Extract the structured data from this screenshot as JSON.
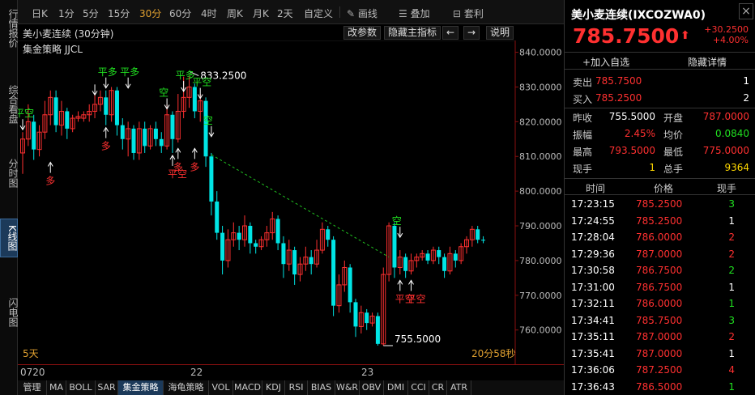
{
  "left_nav": [
    {
      "label": "行情报价",
      "active": false
    },
    {
      "label": "综合看盘",
      "active": false
    },
    {
      "label": "分时图",
      "active": false
    },
    {
      "label": "K线图",
      "active": true
    },
    {
      "label": "闪电图",
      "active": false
    }
  ],
  "toolbar": {
    "periods": [
      "日K",
      "1分",
      "5分",
      "15分",
      "30分",
      "60分",
      "4时",
      "周K",
      "月K",
      "2天",
      "自定义"
    ],
    "active_period": "30分",
    "draw_label": "画线",
    "overlay_label": "叠加",
    "arbitrage_label": "套利"
  },
  "chart_header": {
    "title": "美小麦连续 (30分钟)",
    "change_params": "改参数",
    "hide_indicator": "隐藏主指标",
    "left_arrow": "←",
    "right_arrow": "→",
    "explain": "说明",
    "strategy": "集金策略 JJCL"
  },
  "price_axis": {
    "ticks": [
      "840.0000",
      "830.0000",
      "820.0000",
      "810.0000",
      "800.0000",
      "790.0000",
      "780.0000",
      "770.0000",
      "760.0000"
    ]
  },
  "chart_labels": {
    "high_label": "833.2500",
    "low_label": "755.5000",
    "days": "5天",
    "countdown": "20分58秒"
  },
  "date_axis": [
    "0720",
    "22",
    "23"
  ],
  "signals": {
    "buy_open": "多",
    "close_short": "平空",
    "close_long": "平多",
    "sell_open": "空"
  },
  "chart_data": {
    "type": "candlestick",
    "ylim": [
      752,
      842
    ],
    "candles": [
      {
        "o": 811,
        "c": 815,
        "h": 817,
        "l": 805
      },
      {
        "o": 815,
        "c": 820,
        "h": 825,
        "l": 813
      },
      {
        "o": 820,
        "c": 812,
        "h": 822,
        "l": 809
      },
      {
        "o": 812,
        "c": 817,
        "h": 819,
        "l": 810
      },
      {
        "o": 817,
        "c": 822,
        "h": 826,
        "l": 815
      },
      {
        "o": 822,
        "c": 827,
        "h": 829,
        "l": 819
      },
      {
        "o": 827,
        "c": 819,
        "h": 829,
        "l": 817
      },
      {
        "o": 819,
        "c": 823,
        "h": 826,
        "l": 816
      },
      {
        "o": 823,
        "c": 818,
        "h": 824,
        "l": 815
      },
      {
        "o": 818,
        "c": 821,
        "h": 822,
        "l": 817
      },
      {
        "o": 821,
        "c": 821.5,
        "h": 823,
        "l": 820
      },
      {
        "o": 821,
        "c": 822,
        "h": 823,
        "l": 820
      },
      {
        "o": 822,
        "c": 823,
        "h": 825,
        "l": 820
      },
      {
        "o": 823,
        "c": 825,
        "h": 828,
        "l": 821
      },
      {
        "o": 825,
        "c": 827,
        "h": 829,
        "l": 823
      },
      {
        "o": 827,
        "c": 822,
        "h": 829,
        "l": 819
      },
      {
        "o": 822,
        "c": 829,
        "h": 830,
        "l": 820
      },
      {
        "o": 829,
        "c": 819,
        "h": 830,
        "l": 816
      },
      {
        "o": 819,
        "c": 815,
        "h": 821,
        "l": 812
      },
      {
        "o": 815,
        "c": 818,
        "h": 820,
        "l": 810
      },
      {
        "o": 818,
        "c": 811,
        "h": 819,
        "l": 809
      },
      {
        "o": 811,
        "c": 818,
        "h": 820,
        "l": 809
      },
      {
        "o": 818,
        "c": 813,
        "h": 820,
        "l": 811
      },
      {
        "o": 813,
        "c": 818,
        "h": 819,
        "l": 812
      },
      {
        "o": 818,
        "c": 815,
        "h": 820,
        "l": 813
      },
      {
        "o": 815,
        "c": 813,
        "h": 817,
        "l": 811
      },
      {
        "o": 813,
        "c": 822,
        "h": 825,
        "l": 812
      },
      {
        "o": 822,
        "c": 815,
        "h": 823,
        "l": 811
      },
      {
        "o": 815,
        "c": 823,
        "h": 828,
        "l": 814
      },
      {
        "o": 823,
        "c": 827,
        "h": 833,
        "l": 821
      },
      {
        "o": 827,
        "c": 830,
        "h": 833,
        "l": 824
      },
      {
        "o": 830,
        "c": 823,
        "h": 831,
        "l": 821
      },
      {
        "o": 823,
        "c": 826,
        "h": 828,
        "l": 820
      },
      {
        "o": 826,
        "c": 810,
        "h": 827,
        "l": 807
      },
      {
        "o": 810,
        "c": 797,
        "h": 811,
        "l": 793
      },
      {
        "o": 797,
        "c": 788,
        "h": 800,
        "l": 786
      },
      {
        "o": 788,
        "c": 780,
        "h": 790,
        "l": 776
      },
      {
        "o": 780,
        "c": 786,
        "h": 789,
        "l": 778
      },
      {
        "o": 786,
        "c": 788,
        "h": 791,
        "l": 784
      },
      {
        "o": 788,
        "c": 786,
        "h": 790,
        "l": 783
      },
      {
        "o": 786,
        "c": 790,
        "h": 793,
        "l": 784
      },
      {
        "o": 790,
        "c": 785,
        "h": 791,
        "l": 782
      },
      {
        "o": 785,
        "c": 784,
        "h": 786,
        "l": 782
      },
      {
        "o": 784,
        "c": 786,
        "h": 787,
        "l": 783
      },
      {
        "o": 786,
        "c": 788,
        "h": 790,
        "l": 784
      },
      {
        "o": 788,
        "c": 792,
        "h": 794,
        "l": 786
      },
      {
        "o": 792,
        "c": 785,
        "h": 793,
        "l": 783
      },
      {
        "o": 785,
        "c": 779,
        "h": 787,
        "l": 775
      },
      {
        "o": 779,
        "c": 783,
        "h": 786,
        "l": 777
      },
      {
        "o": 783,
        "c": 776,
        "h": 784,
        "l": 773
      },
      {
        "o": 776,
        "c": 779,
        "h": 781,
        "l": 774
      },
      {
        "o": 779,
        "c": 781,
        "h": 784,
        "l": 777
      },
      {
        "o": 781,
        "c": 779,
        "h": 783,
        "l": 776
      },
      {
        "o": 779,
        "c": 783,
        "h": 786,
        "l": 778
      },
      {
        "o": 783,
        "c": 789,
        "h": 791,
        "l": 782
      },
      {
        "o": 789,
        "c": 786,
        "h": 790,
        "l": 784
      },
      {
        "o": 786,
        "c": 767,
        "h": 787,
        "l": 764
      },
      {
        "o": 767,
        "c": 773,
        "h": 776,
        "l": 765
      },
      {
        "o": 773,
        "c": 778,
        "h": 780,
        "l": 771
      },
      {
        "o": 778,
        "c": 768,
        "h": 779,
        "l": 765
      },
      {
        "o": 768,
        "c": 761,
        "h": 769,
        "l": 758
      },
      {
        "o": 761,
        "c": 765,
        "h": 767,
        "l": 759
      },
      {
        "o": 765,
        "c": 762,
        "h": 766,
        "l": 760
      },
      {
        "o": 762,
        "c": 764,
        "h": 765,
        "l": 761
      },
      {
        "o": 764,
        "c": 756,
        "h": 765,
        "l": 755.5
      },
      {
        "o": 756,
        "c": 776,
        "h": 778,
        "l": 755.5
      },
      {
        "o": 776,
        "c": 790,
        "h": 791,
        "l": 774
      },
      {
        "o": 790,
        "c": 778,
        "h": 791,
        "l": 775
      },
      {
        "o": 778,
        "c": 781,
        "h": 783,
        "l": 776
      },
      {
        "o": 781,
        "c": 777,
        "h": 782,
        "l": 775
      },
      {
        "o": 777,
        "c": 780,
        "h": 782,
        "l": 776
      },
      {
        "o": 780,
        "c": 781,
        "h": 782,
        "l": 778
      },
      {
        "o": 781,
        "c": 782,
        "h": 783,
        "l": 780
      },
      {
        "o": 782,
        "c": 780,
        "h": 783,
        "l": 779
      },
      {
        "o": 780,
        "c": 783,
        "h": 784,
        "l": 779
      },
      {
        "o": 783,
        "c": 781,
        "h": 784,
        "l": 779
      },
      {
        "o": 781,
        "c": 777,
        "h": 782,
        "l": 775
      },
      {
        "o": 777,
        "c": 782,
        "h": 784,
        "l": 776
      },
      {
        "o": 782,
        "c": 780,
        "h": 783,
        "l": 778
      },
      {
        "o": 780,
        "c": 784,
        "h": 785,
        "l": 779
      },
      {
        "o": 784,
        "c": 786,
        "h": 787,
        "l": 782
      },
      {
        "o": 786,
        "c": 789,
        "h": 790,
        "l": 784
      },
      {
        "o": 789,
        "c": 786,
        "h": 790,
        "l": 785
      },
      {
        "o": 786,
        "c": 785.75,
        "h": 787,
        "l": 785
      }
    ],
    "trendline": {
      "from": 810.5,
      "to": 781
    }
  },
  "quote": {
    "name": "美小麦连续(IXCOZWA0)",
    "close_icon": "×",
    "price": "785.7500",
    "change": "+30.2500",
    "change_pct": "+4.00%",
    "add_favorite": "加入自选",
    "hide_detail": "隐藏详情",
    "ask_label": "卖出",
    "ask": "785.7500",
    "ask_vol": "1",
    "bid_label": "买入",
    "bid": "785.2500",
    "bid_vol": "2",
    "stats": [
      {
        "l1": "昨收",
        "v1": "755.5000",
        "c1": "white",
        "l2": "开盘",
        "v2": "787.0000",
        "c2": "red"
      },
      {
        "l1": "振幅",
        "v1": "2.45%",
        "c1": "red",
        "l2": "均价",
        "v2": "0.0840",
        "c2": "green"
      },
      {
        "l1": "最高",
        "v1": "793.5000",
        "c1": "red",
        "l2": "最低",
        "v2": "775.0000",
        "c2": "red"
      },
      {
        "l1": "现手",
        "v1": "1",
        "c1": "yellow",
        "l2": "总手",
        "v2": "9364",
        "c2": "yellow"
      }
    ],
    "tick_headers": [
      "时间",
      "价格",
      "现手"
    ],
    "ticks": [
      {
        "time": "17:23:15",
        "price": "785.2500",
        "vol": "3",
        "vc": "green"
      },
      {
        "time": "17:24:55",
        "price": "785.2500",
        "vol": "1",
        "vc": "white"
      },
      {
        "time": "17:28:04",
        "price": "786.0000",
        "vol": "2",
        "vc": "red"
      },
      {
        "time": "17:29:36",
        "price": "787.0000",
        "vol": "2",
        "vc": "red"
      },
      {
        "time": "17:30:58",
        "price": "786.7500",
        "vol": "2",
        "vc": "green"
      },
      {
        "time": "17:31:00",
        "price": "786.7500",
        "vol": "1",
        "vc": "white"
      },
      {
        "time": "17:32:11",
        "price": "786.0000",
        "vol": "1",
        "vc": "green"
      },
      {
        "time": "17:34:41",
        "price": "785.7500",
        "vol": "3",
        "vc": "green"
      },
      {
        "time": "17:35:11",
        "price": "787.0000",
        "vol": "2",
        "vc": "red"
      },
      {
        "time": "17:35:41",
        "price": "787.0000",
        "vol": "1",
        "vc": "white"
      },
      {
        "time": "17:36:06",
        "price": "787.2500",
        "vol": "4",
        "vc": "red"
      },
      {
        "time": "17:36:43",
        "price": "786.5000",
        "vol": "1",
        "vc": "green"
      }
    ]
  },
  "indicator_tabs": [
    "管理",
    "MA",
    "BOLL",
    "SAR",
    "集金策略",
    "海龟策略",
    "VOL",
    "MACD",
    "KDJ",
    "RSI",
    "BIAS",
    "W&R",
    "OBV",
    "DMI",
    "CCI",
    "CR",
    "ATR"
  ],
  "active_indicator": "集金策略"
}
